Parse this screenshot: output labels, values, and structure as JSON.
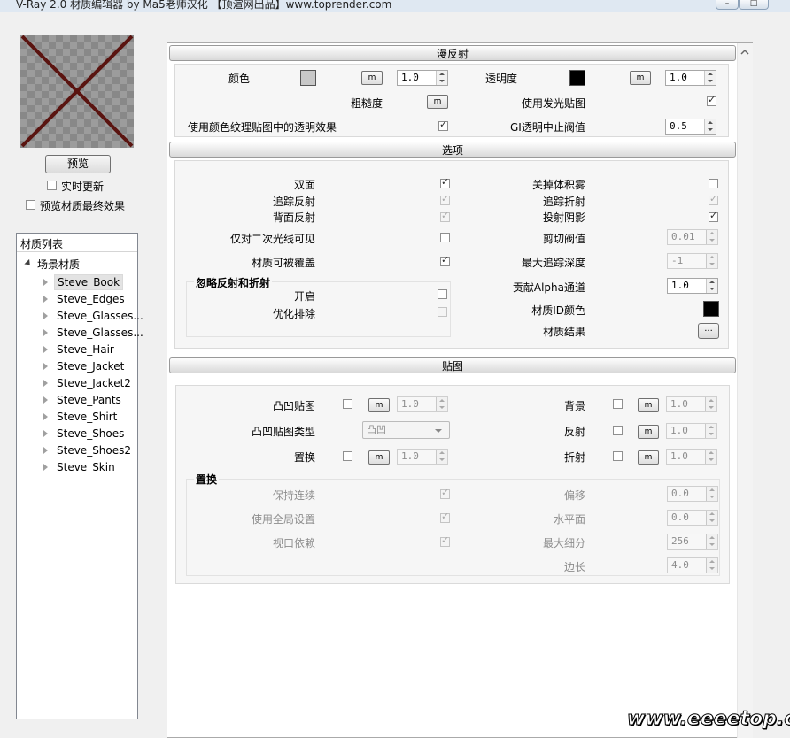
{
  "window": {
    "title": "V-Ray 2.0 材质编辑器 by Ma5老师汉化 【顶渲网出品】www.toprender.com",
    "btn_min": "–",
    "btn_max": "□"
  },
  "left": {
    "preview_btn": "预览",
    "realtime_update": "实时更新",
    "preview_final": "预览材质最终效果",
    "tree_header": "材质列表",
    "tree_root": "场景材质",
    "materials": [
      "Steve_Book",
      "Steve_Edges",
      "Steve_Glasses...",
      "Steve_Glasses...",
      "Steve_Hair",
      "Steve_Jacket",
      "Steve_Jacket2",
      "Steve_Pants",
      "Steve_Shirt",
      "Steve_Shoes",
      "Steve_Shoes2",
      "Steve_Skin"
    ]
  },
  "diffuse": {
    "title": "漫反射",
    "color_label": "颜色",
    "color_value": "1.0",
    "transparency_label": "透明度",
    "transparency_value": "1.0",
    "roughness_label": "粗糙度",
    "use_glow_map": "使用发光贴图",
    "use_texture_transp": "使用颜色纹理贴图中的透明效果",
    "gi_cutoff_label": "GI透明中止阀值",
    "gi_cutoff_value": "0.5",
    "m": "m",
    "color_swatch": "#c8c8c8",
    "transp_swatch": "#000000"
  },
  "options": {
    "title": "选项",
    "double_sided": "双面",
    "trace_reflection": "追踪反射",
    "back_reflection": "背面反射",
    "secondary_only": "仅对二次光线可见",
    "overridable": "材质可被覆盖",
    "ignore_group": "忽略反射和折射",
    "ignore_on": "开启",
    "optimize_exclusion": "优化排除",
    "disable_volume_fog": "关掉体积雾",
    "trace_refraction": "追踪折射",
    "cast_shadows": "投射阴影",
    "clip_threshold": "剪切阀值",
    "clip_value": "0.01",
    "max_trace_depth": "最大追踪深度",
    "max_trace_value": "-1",
    "alpha_contrib": "贡献Alpha通道",
    "alpha_value": "1.0",
    "material_id_color": "材质ID颜色",
    "material_result": "材质结果",
    "result_btn": "...",
    "id_swatch": "#000000"
  },
  "maps": {
    "title": "贴图",
    "bump_map": "凸凹贴图",
    "bump_value": "1.0",
    "bump_type": "凸凹贴图类型",
    "bump_type_value": "凸凹",
    "displacement": "置换",
    "displacement_value": "1.0",
    "background": "背景",
    "background_value": "1.0",
    "reflection": "反射",
    "reflection_value": "1.0",
    "refraction": "折射",
    "refraction_value": "1.0",
    "disp_group": "置换",
    "keep_continuity": "保持连续",
    "use_global": "使用全局设置",
    "view_dependent": "视口依赖",
    "shift": "偏移",
    "shift_value": "0.0",
    "water_level": "水平面",
    "water_value": "0.0",
    "max_subdivs": "最大细分",
    "max_subdivs_value": "256",
    "edge_length": "边长",
    "edge_length_value": "4.0"
  },
  "watermark": "www.eeeetop.com"
}
